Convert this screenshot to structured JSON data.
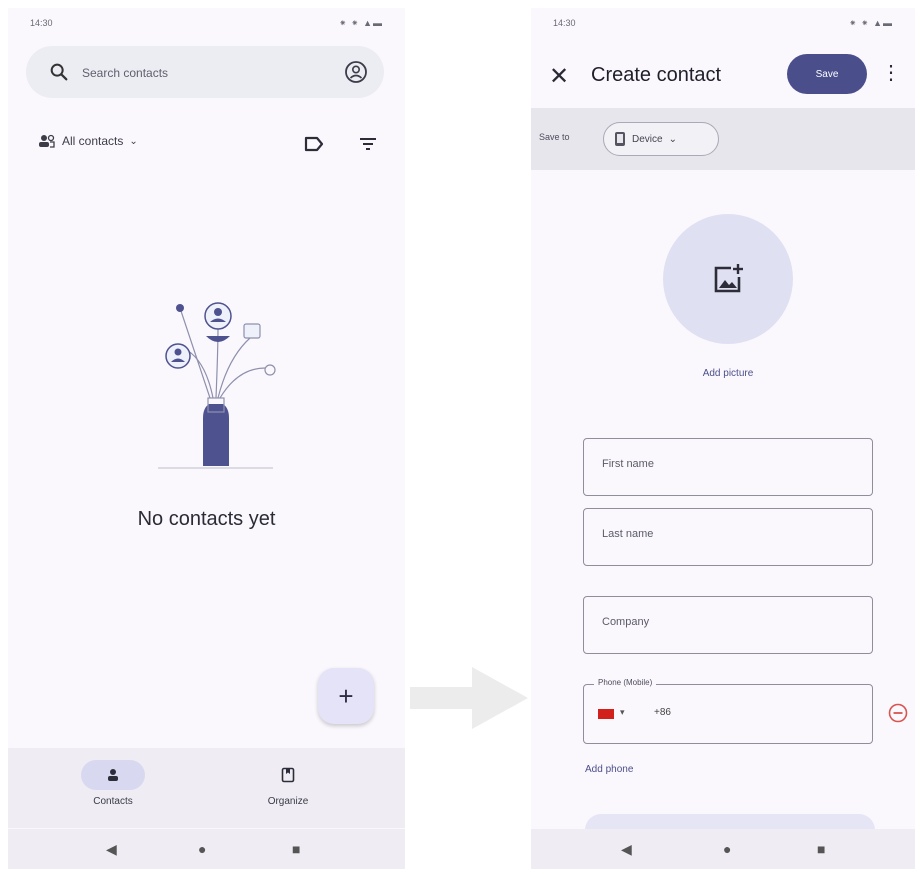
{
  "left_screen": {
    "status": {
      "time": "14:30",
      "icons": "⁕ ⁕ ▲▬"
    },
    "search": {
      "placeholder": "Search contacts"
    },
    "filter": {
      "label": "All contacts"
    },
    "empty_state": {
      "text": "No contacts yet"
    },
    "fab": {
      "label": "+"
    },
    "bottom_nav": {
      "contacts": "Contacts",
      "organize": "Organize"
    },
    "system_nav": {
      "back": "◀",
      "home": "●",
      "recents": "■"
    }
  },
  "right_screen": {
    "status": {
      "time": "14:30",
      "icons": "⁕ ⁕ ▲▬"
    },
    "title": "Create contact",
    "save_label": "Save",
    "more": "⋮",
    "close": "✕",
    "save_to": {
      "label": "Save to",
      "device": "Device"
    },
    "add_picture": "Add picture",
    "fields": {
      "first_name": "First name",
      "last_name": "Last name",
      "company": "Company",
      "phone_label": "Phone (Mobile)",
      "country_code": "+86"
    },
    "add_phone": "Add phone",
    "system_nav": {
      "back": "◀",
      "home": "●",
      "recents": "■"
    }
  },
  "colors": {
    "primary": "#4a4f8c",
    "surface": "#fbf8fd",
    "chip": "#e0e0f3",
    "remove": "#d9534f"
  }
}
